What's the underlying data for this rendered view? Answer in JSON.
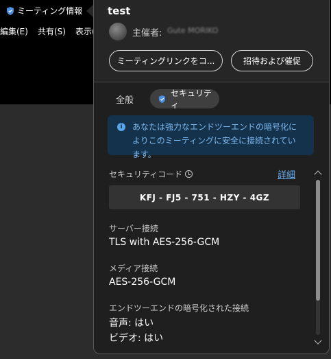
{
  "background": {
    "window_title": "ミーティング情報",
    "menu": [
      "編集(E)",
      "共有(S)",
      "表示("
    ]
  },
  "popup": {
    "title": "test",
    "host_label": "主催者:",
    "host_name": "Gute MORIKO",
    "copy_link_button": "ミーティングリンクをコ...",
    "invite_button": "招待および催促",
    "tabs": {
      "general": "全般",
      "security": "セキュリティ"
    },
    "info_icon": "info-icon",
    "info_text": "あなたは強力なエンドツーエンドの暗号化によりこのミーティングに安全に接続されています。",
    "security_code_label": "セキュリティコード",
    "details_link": "詳細",
    "security_code": "KFJ - FJ5 - 751 - HZY - 4GZ",
    "server_connection_label": "サーバー接続",
    "server_connection_value": "TLS with AES-256-GCM",
    "media_connection_label": "メディア接続",
    "media_connection_value": "AES-256-GCM",
    "e2e_label": "エンドツーエンドの暗号化された接続",
    "audio_value": "音声: はい",
    "video_value": "ビデオ: はい"
  },
  "colors": {
    "accent": "#6aaef0",
    "info_bg": "#15324c",
    "shield_blue": "#4a8fe0"
  }
}
